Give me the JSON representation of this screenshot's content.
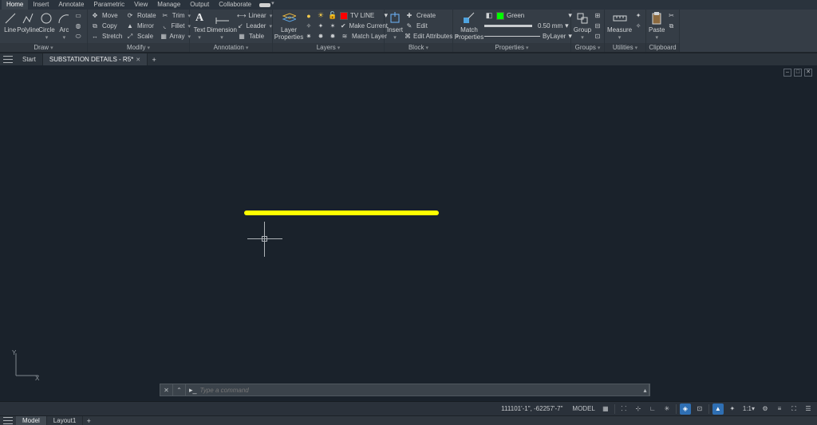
{
  "menu": {
    "items": [
      "Home",
      "Insert",
      "Annotate",
      "Parametric",
      "View",
      "Manage",
      "Output",
      "Collaborate"
    ],
    "active_index": 0
  },
  "ribbon": {
    "draw": {
      "title": "Draw",
      "line": "Line",
      "polyline": "Polyline",
      "circle": "Circle",
      "arc": "Arc"
    },
    "modify": {
      "title": "Modify",
      "move": "Move",
      "rotate": "Rotate",
      "trim": "Trim",
      "copy": "Copy",
      "mirror": "Mirror",
      "fillet": "Fillet",
      "stretch": "Stretch",
      "scale": "Scale",
      "array": "Array"
    },
    "annotation": {
      "title": "Annotation",
      "text": "Text",
      "dimension": "Dimension",
      "linear": "Linear",
      "leader": "Leader",
      "table": "Table"
    },
    "layers": {
      "title": "Layers",
      "props": "Layer\nProperties",
      "current": "TV LINE",
      "make_current": "Make Current",
      "match": "Match Layer"
    },
    "block": {
      "title": "Block",
      "insert": "Insert",
      "create": "Create",
      "edit": "Edit",
      "edit_attr": "Edit Attributes"
    },
    "properties": {
      "title": "Properties",
      "match": "Match\nProperties",
      "color": "Green",
      "lineweight": "0.50 mm",
      "linetype": "ByLayer"
    },
    "groups": {
      "title": "Groups",
      "group": "Group"
    },
    "utilities": {
      "title": "Utilities",
      "measure": "Measure"
    },
    "clipboard": {
      "title": "Clipboard",
      "paste": "Paste"
    }
  },
  "tabs": {
    "start": "Start",
    "file": "SUBSTATION DETAILS - R5*"
  },
  "cmd": {
    "placeholder": "Type a command"
  },
  "layout": {
    "model": "Model",
    "layout1": "Layout1"
  },
  "status": {
    "coords": "111101'-1\", -62257'-7\"",
    "space": "MODEL",
    "scale": "1:1"
  },
  "ucs": {
    "x": "X",
    "y": "Y"
  },
  "colors": {
    "accent": "#ffff00",
    "layer_swatch": "#00ff00",
    "tv_line_swatch": "#ff0000"
  },
  "icons": {
    "search": "⌕",
    "gear": "⚙",
    "chev": "▾",
    "close": "✕",
    "plus": "+",
    "grid": "▦",
    "pin": "📍",
    "lock": "🔒",
    "iso": "◈",
    "ortho": "⊞",
    "snap": "⊙",
    "dyn": "⌨"
  }
}
